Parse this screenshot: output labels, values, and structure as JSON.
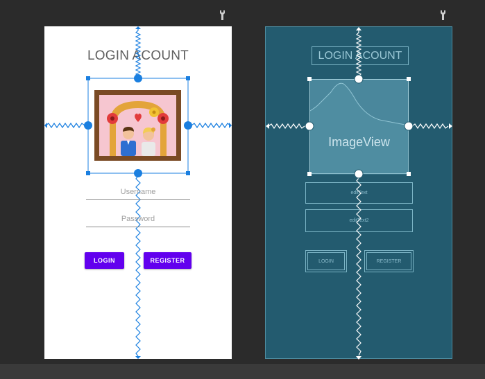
{
  "design": {
    "title": "LOGIN ACOUNT",
    "username_hint": "Username",
    "password_hint": "Password",
    "login_label": "LOGIN",
    "register_label": "REGISTER"
  },
  "blueprint": {
    "title": "LOGIN ACOUNT",
    "image_label": "ImageView",
    "edittext1_label": "editText",
    "edittext2_label": "editText2",
    "login_label": "LOGIN",
    "register_label": "REGISTER"
  },
  "colors": {
    "canvas_bg": "#2b2b2b",
    "blueprint_bg": "#235b6f",
    "accent_button": "#6200ee",
    "constraint_blue": "#1a7fe0"
  },
  "icons": [
    "wrench-icon",
    "couple-picture-icon",
    "chart-placeholder-icon"
  ]
}
